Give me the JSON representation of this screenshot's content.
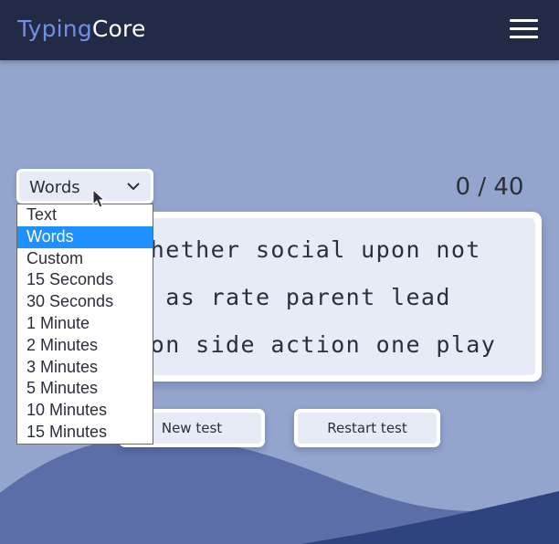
{
  "app": {
    "brand_part1": "Typing",
    "brand_part2": "Core"
  },
  "counter": {
    "typed": "0",
    "separator": "/",
    "total": "40"
  },
  "text_lines": [
    "   whether social upon not",
    "   e as rate parent lead",
    "   ion side action one play"
  ],
  "buttons": {
    "new_test": "New test",
    "restart_test": "Restart test"
  },
  "mode_select": {
    "value": "Words",
    "options": [
      "Text",
      "Words",
      "Custom",
      "15 Seconds",
      "30 Seconds",
      "1 Minute",
      "2 Minutes",
      "3 Minutes",
      "5 Minutes",
      "10 Minutes",
      "15 Minutes"
    ],
    "selected_index": 1
  },
  "colors": {
    "topbar": "#232a45",
    "background": "#93a5cc",
    "brand_accent": "#6f8fe6",
    "wave_light": "#5b6ea7",
    "wave_dark": "#2e4380",
    "highlight": "#1e90ff"
  },
  "icons": {
    "menu": "hamburger-icon",
    "chevron": "chevron-down-icon",
    "pointer": "mouse-pointer-icon"
  }
}
